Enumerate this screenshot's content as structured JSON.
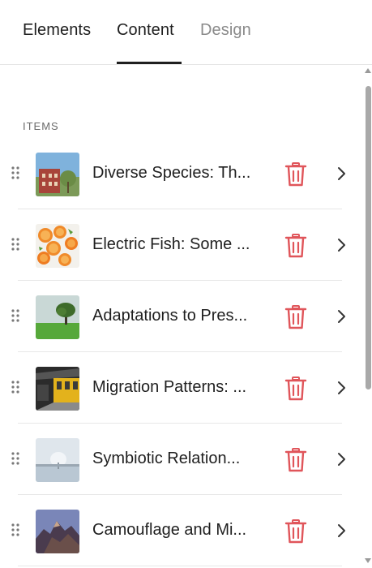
{
  "tabs": [
    {
      "label": "Elements",
      "active": false
    },
    {
      "label": "Content",
      "active": true
    },
    {
      "label": "Design",
      "active": false
    }
  ],
  "section_label": "ITEMS",
  "items": [
    {
      "title": "Diverse Species: Th...",
      "thumb_icon": "red-building-image"
    },
    {
      "title": "Electric Fish: Some ...",
      "thumb_icon": "orange-slices-image"
    },
    {
      "title": "Adaptations to Pres...",
      "thumb_icon": "tree-field-image"
    },
    {
      "title": "Migration Patterns: ...",
      "thumb_icon": "yellow-train-image"
    },
    {
      "title": "Symbiotic Relation...",
      "thumb_icon": "frozen-lake-image"
    },
    {
      "title": "Camouflage and Mi...",
      "thumb_icon": "rocky-mountain-image"
    }
  ],
  "colors": {
    "delete_icon": "#e0555a",
    "active_tab": "#1f1f1f",
    "inactive_tab": "#8a8a8a"
  },
  "icons": {
    "drag": "drag-handle-icon",
    "delete": "trash-icon",
    "open": "chevron-right-icon"
  }
}
